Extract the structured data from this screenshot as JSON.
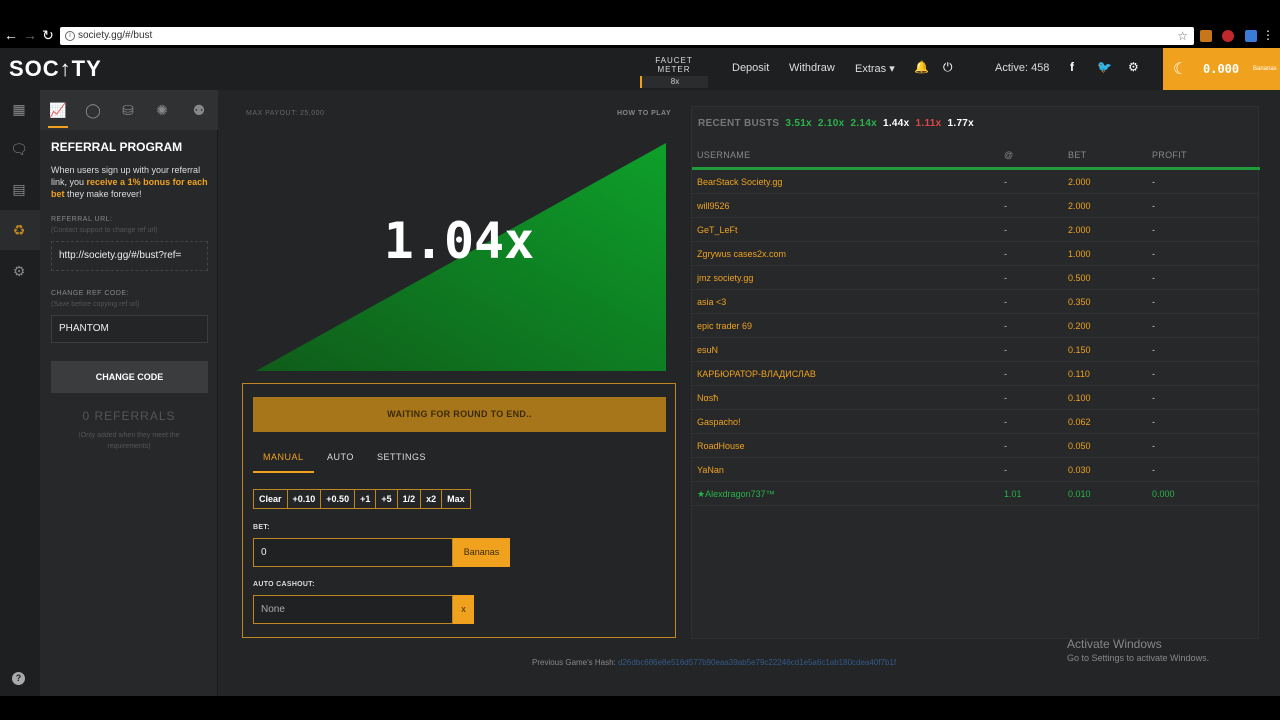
{
  "browser": {
    "url": "society.gg/#/bust"
  },
  "header": {
    "logo": "SOC↑TY",
    "faucet_label": "FAUCET METER",
    "faucet_value": "8x",
    "deposit": "Deposit",
    "withdraw": "Withdraw",
    "extras": "Extras ▾",
    "active": "Active: 458",
    "balance": "0.000",
    "balance_unit": "Bananas"
  },
  "sidebar": {
    "title": "REFERRAL PROGRAM",
    "desc_1": "When users sign up with your referral link, you ",
    "desc_bold": "receive a 1% bonus for each bet",
    "desc_2": " they make forever!",
    "ref_url_label": "REFERRAL URL:",
    "ref_url_sub": "(Contact support to change ref url)",
    "ref_url_value": "http://society.gg/#/bust?ref=",
    "change_ref_label": "CHANGE REF CODE:",
    "change_ref_sub": "(Save before copying ref url)",
    "ref_code_value": "PHANTOM",
    "change_code_button": "CHANGE CODE",
    "referrals_count": "0 REFERRALS",
    "referrals_note": "(Only added when they meet the requirements)"
  },
  "game": {
    "max_payout": "MAX PAYOUT: 25,000",
    "how_to_play": "HOW TO PLAY",
    "multiplier": "1.04x",
    "waiting": "WAITING FOR ROUND TO END..",
    "tabs": [
      "MANUAL",
      "AUTO",
      "SETTINGS"
    ],
    "quick_buttons": [
      "Clear",
      "+0.10",
      "+0.50",
      "+1",
      "+5",
      "1/2",
      "x2",
      "Max"
    ],
    "bet_label": "BET:",
    "bet_value": "0",
    "bet_unit": "Bananas",
    "auto_cashout_label": "AUTO CASHOUT:",
    "auto_cashout_value": "None",
    "auto_cashout_clear": "x",
    "prev_hash_label": "Previous Game's Hash:",
    "prev_hash_value": "d26dbc686e8e516d577b90eaa39ab5e79c22246cd1e5a6c1ab180cdea40f7b1f"
  },
  "busts": {
    "label": "RECENT BUSTS",
    "values": [
      {
        "v": "3.51x",
        "color": "#2bb34a"
      },
      {
        "v": "2.10x",
        "color": "#2bb34a"
      },
      {
        "v": "2.14x",
        "color": "#2bb34a"
      },
      {
        "v": "1.44x",
        "color": "#ffffff"
      },
      {
        "v": "1.11x",
        "color": "#e04545"
      },
      {
        "v": "1.77x",
        "color": "#ffffff"
      }
    ]
  },
  "table": {
    "headers": {
      "user": "USERNAME",
      "at": "@",
      "bet": "BET",
      "profit": "PROFIT"
    },
    "rows": [
      {
        "user": "BearStack Society.gg",
        "at": "-",
        "bet": "2.000",
        "profit": "-"
      },
      {
        "user": "will9526",
        "at": "-",
        "bet": "2.000",
        "profit": "-"
      },
      {
        "user": "GeT_LeFt",
        "at": "-",
        "bet": "2.000",
        "profit": "-"
      },
      {
        "user": "Zgrywus cases2x.com",
        "at": "-",
        "bet": "1.000",
        "profit": "-"
      },
      {
        "user": "jmz society.gg",
        "at": "-",
        "bet": "0.500",
        "profit": "-"
      },
      {
        "user": "asia <3",
        "at": "-",
        "bet": "0.350",
        "profit": "-"
      },
      {
        "user": "epic trader 69",
        "at": "-",
        "bet": "0.200",
        "profit": "-"
      },
      {
        "user": "esuN",
        "at": "-",
        "bet": "0.150",
        "profit": "-"
      },
      {
        "user": "КАРБЮРАТОР-ВЛАДИСЛАВ",
        "at": "-",
        "bet": "0.110",
        "profit": "-"
      },
      {
        "user": "Nαѕħ",
        "at": "-",
        "bet": "0.100",
        "profit": "-"
      },
      {
        "user": "Gaspacho!",
        "at": "-",
        "bet": "0.062",
        "profit": "-"
      },
      {
        "user": "RoadHouse",
        "at": "-",
        "bet": "0.050",
        "profit": "-"
      },
      {
        "user": "YaNan",
        "at": "-",
        "bet": "0.030",
        "profit": "-"
      },
      {
        "user": "★Alexdragon737™",
        "at": "1.01",
        "bet": "0.010",
        "profit": "0.000",
        "won": true
      }
    ]
  },
  "windows": {
    "activate_title": "Activate Windows",
    "activate_sub": "Go to Settings to activate Windows."
  },
  "colors": {
    "accent": "#f0a21e",
    "win_green": "#2bb34a",
    "loss_red": "#e04545"
  }
}
